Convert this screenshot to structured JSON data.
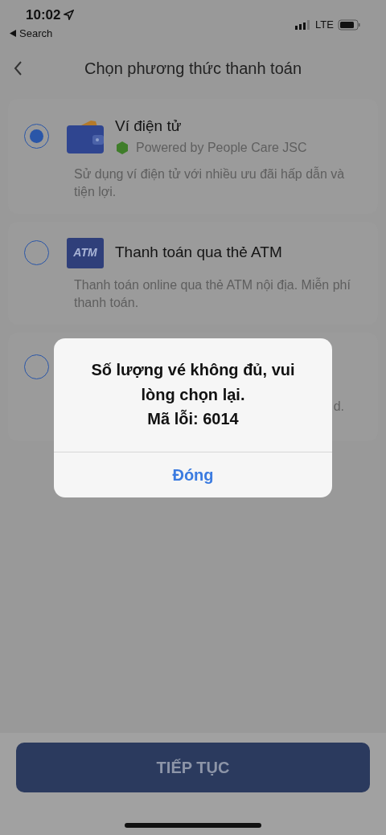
{
  "status_bar": {
    "time": "10:02",
    "back_app": "Search",
    "network": "LTE"
  },
  "header": {
    "title": "Chọn phương thức thanh toán"
  },
  "methods": [
    {
      "kind": "wallet",
      "selected": true,
      "title": "Ví điện tử",
      "subtitle": "Powered by People Care JSC",
      "description": "Sử dụng ví điện tử với nhiều ưu đãi hấp dẫn và tiện lợi."
    },
    {
      "kind": "atm",
      "selected": false,
      "icon_text": "ATM",
      "title": "Thanh toán qua thẻ ATM",
      "description": "Thanh toán online qua thẻ ATM nội địa. Miễn phí thanh toán."
    },
    {
      "kind": "covered",
      "selected": false,
      "description": "d."
    }
  ],
  "alert": {
    "message": "Số lượng vé không đủ, vui lòng chọn lại.",
    "code": "Mã lỗi: 6014",
    "button": "Đóng"
  },
  "footer": {
    "button": "TIẾP TỤC"
  }
}
